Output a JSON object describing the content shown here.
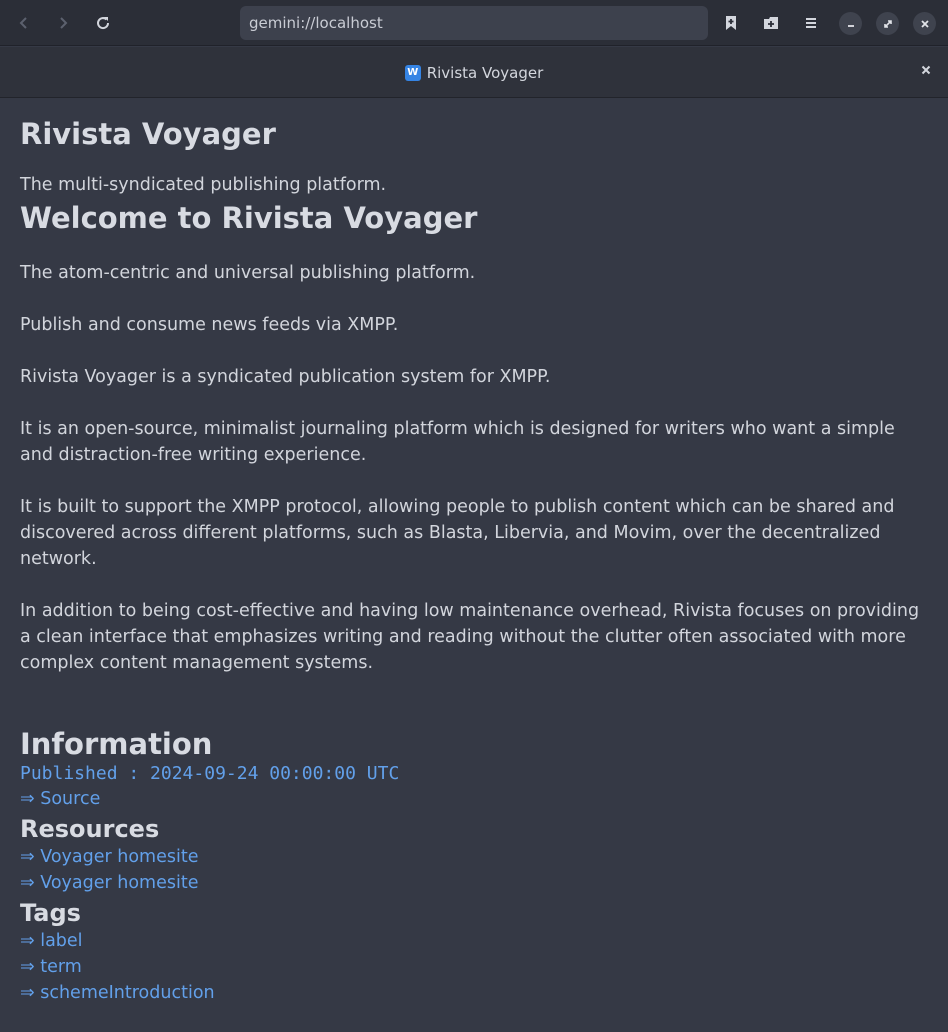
{
  "toolbar": {
    "url": "gemini://localhost"
  },
  "tab": {
    "title": "Rivista Voyager",
    "favicon_letter": "W"
  },
  "page": {
    "title": "Rivista Voyager",
    "subtitle": "The multi-syndicated publishing platform.",
    "welcome_heading": "Welcome to Rivista Voyager",
    "paragraphs": [
      "The atom-centric and universal publishing platform.",
      "Publish and consume news feeds via XMPP.",
      "Rivista Voyager is a syndicated publication system for XMPP.",
      "It is an open-source, minimalist journaling platform which is designed for writers who want a simple and distraction-free writing experience.",
      "It is built to support the XMPP protocol, allowing people to publish content which can be shared and discovered across different platforms, such as Blasta, Libervia, and Movim, over the decentralized network.",
      "In addition to being cost-effective and having low maintenance overhead, Rivista focuses on providing a clean interface that emphasizes writing and reading without the clutter often associated with more complex content management systems."
    ],
    "information_heading": "Information",
    "published": "Published : 2024-09-24 00:00:00 UTC",
    "source_link": "⇒ Source",
    "resources_heading": "Resources",
    "resources": [
      "⇒ Voyager homesite",
      "⇒ Voyager homesite"
    ],
    "tags_heading": "Tags",
    "tags": [
      "⇒ label",
      "⇒ term",
      "⇒ schemeIntroduction"
    ]
  },
  "colors": {
    "background": "#353945",
    "link": "#62a0ea",
    "accent_favicon": "#3584e4"
  }
}
